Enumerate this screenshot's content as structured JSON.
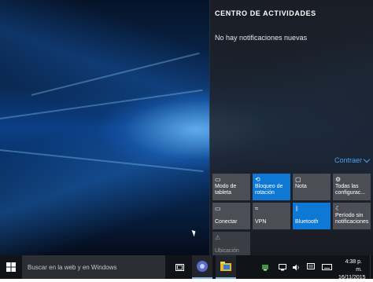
{
  "action_center": {
    "title": "CENTRO DE ACTIVIDADES",
    "empty_message": "No hay notificaciones nuevas",
    "collapse_label": "Contraer",
    "tiles": [
      {
        "icon": "tablet-mode-icon",
        "glyph": "▭",
        "label_1": "Modo de",
        "label_2": "tableta",
        "state": "off"
      },
      {
        "icon": "rotation-lock-icon",
        "glyph": "⟲",
        "label_1": "Bloqueo de",
        "label_2": "rotación",
        "state": "on"
      },
      {
        "icon": "note-icon",
        "glyph": "▢",
        "label_1": "Nota",
        "label_2": "",
        "state": "off"
      },
      {
        "icon": "settings-icon",
        "glyph": "⚙",
        "label_1": "Todas las",
        "label_2": "configurac...",
        "state": "off"
      },
      {
        "icon": "connect-icon",
        "glyph": "▭",
        "label_1": "Conectar",
        "label_2": "",
        "state": "off"
      },
      {
        "icon": "vpn-icon",
        "glyph": "≈",
        "label_1": "VPN",
        "label_2": "",
        "state": "off"
      },
      {
        "icon": "bluetooth-icon",
        "glyph": "ᛒ",
        "label_1": "Bluetooth",
        "label_2": "",
        "state": "on"
      },
      {
        "icon": "quiet-hours-icon",
        "glyph": "☾",
        "label_1": "Período sin",
        "label_2": "notificaciones",
        "state": "off"
      },
      {
        "icon": "location-icon",
        "glyph": "⚠",
        "label_1": "Ubicación",
        "label_2": "",
        "state": "disabled"
      }
    ]
  },
  "taskbar": {
    "search_placeholder": "Buscar en la web y en Windows",
    "clock_time": "4:38 p. m.",
    "clock_date": "16/11/2015"
  },
  "colors": {
    "accent": "#0f78d4",
    "link": "#4aa0e6",
    "tile_off": "#4b4f55"
  }
}
